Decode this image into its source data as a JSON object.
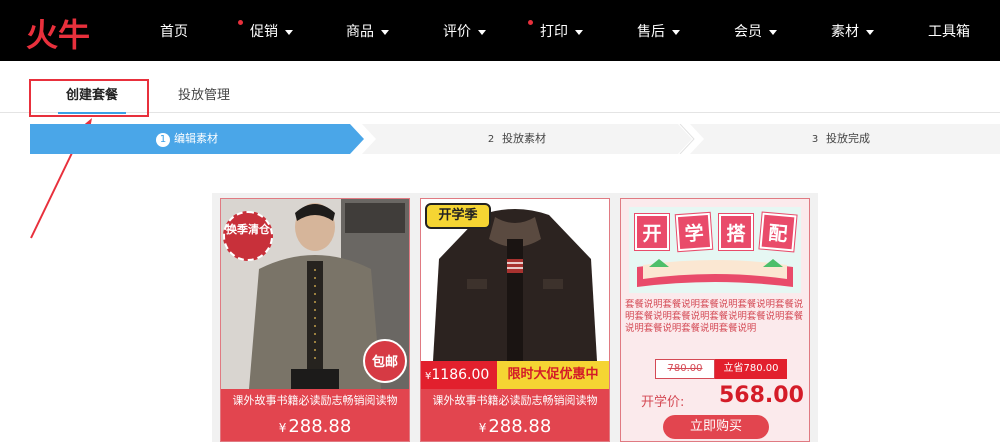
{
  "brand": {
    "logo_text": "火牛",
    "accent_color": "#e8303c",
    "tab_underline_color": "#3ba0e6",
    "step_active_color": "#4aa6e8"
  },
  "nav": {
    "items": [
      {
        "label": "首页",
        "dropdown": false,
        "dot": false
      },
      {
        "label": "促销",
        "dropdown": true,
        "dot": true
      },
      {
        "label": "商品",
        "dropdown": true,
        "dot": false
      },
      {
        "label": "评价",
        "dropdown": true,
        "dot": false
      },
      {
        "label": "打印",
        "dropdown": true,
        "dot": true
      },
      {
        "label": "售后",
        "dropdown": true,
        "dot": false
      },
      {
        "label": "会员",
        "dropdown": true,
        "dot": false
      },
      {
        "label": "素材",
        "dropdown": true,
        "dot": false
      },
      {
        "label": "工具箱",
        "dropdown": false,
        "dot": false
      }
    ]
  },
  "tabs": {
    "active": "创建套餐",
    "second": "投放管理"
  },
  "steps": [
    {
      "num": "1",
      "label": "编辑素材"
    },
    {
      "num": "2",
      "label": "投放素材"
    },
    {
      "num": "3",
      "label": "投放完成"
    }
  ],
  "cards": {
    "card1": {
      "badge_top": "换季清仓",
      "badge_bottom": "包邮",
      "caption": "课外故事书籍必读励志畅销阅读物",
      "yen": "¥",
      "price": "288.88"
    },
    "card2": {
      "badge": "开学季",
      "strip_yen": "¥",
      "strip_price": "1186.00",
      "strip_promo": "限时大促优惠中",
      "caption": "课外故事书籍必读励志畅销阅读物",
      "yen": "¥",
      "price": "288.88"
    },
    "card3": {
      "title_chars": [
        "开",
        "学",
        "搭",
        "配"
      ],
      "desc": "套餐说明套餐说明套餐说明套餐说明套餐说明套餐说明套餐说明套餐说明套餐说明套餐说明套餐说明套餐说明套餐说明",
      "orig_price": "780.00",
      "save_price": "立省780.00",
      "final_label": "开学价:",
      "final_price": "568.00",
      "buy_label": "立即购买"
    }
  }
}
